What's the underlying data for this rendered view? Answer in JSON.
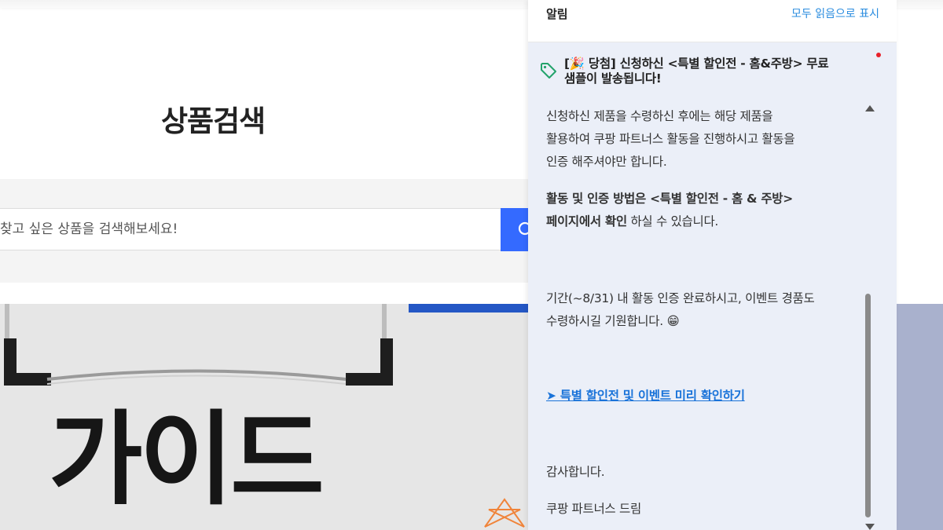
{
  "page": {
    "title": "상품검색",
    "search_placeholder": "찾고 싶은 상품을 검색해보세요!"
  },
  "banner": {
    "text": "가이드"
  },
  "notifications": {
    "title": "알림",
    "mark_all_read": "모두 읽음으로 표시",
    "item": {
      "subject_line1": "[🎉 당첨] 신청하신 <특별 할인전 - 홈&주방> 무료",
      "subject_line2": "샘플이 발송됩니다!",
      "unread": true,
      "body": {
        "p1_line1": "신청하신 제품을 수령하신 후에는 해당 제품을",
        "p1_line2": "활용하여 쿠팡 파트너스 활동을 진행하시고 활동을",
        "p1_line3": "인증 해주셔야만 합니다.",
        "p2_line1": "활동 및 인증 방법은 <특별 할인전 - 홈 & 주방>",
        "p2_line2_bold": "페이지에서 확인",
        "p2_line2_rest": " 하실 수 있습니다.",
        "p3_line1": "기간(~8/31) 내 활동 인증 완료하시고, 이벤트 경품도",
        "p3_line2": "수령하시길 기원합니다. 😁",
        "link": "➤ 특별 할인전 및 이벤트 미리 확인하기",
        "thanks": "감사합니다.",
        "signature": "쿠팡 파트너스 드림"
      }
    }
  },
  "colors": {
    "accent_blue": "#346aff",
    "link_blue": "#1a73d9",
    "unread_red": "#e8202a",
    "panel_bg": "#ebeff8"
  }
}
